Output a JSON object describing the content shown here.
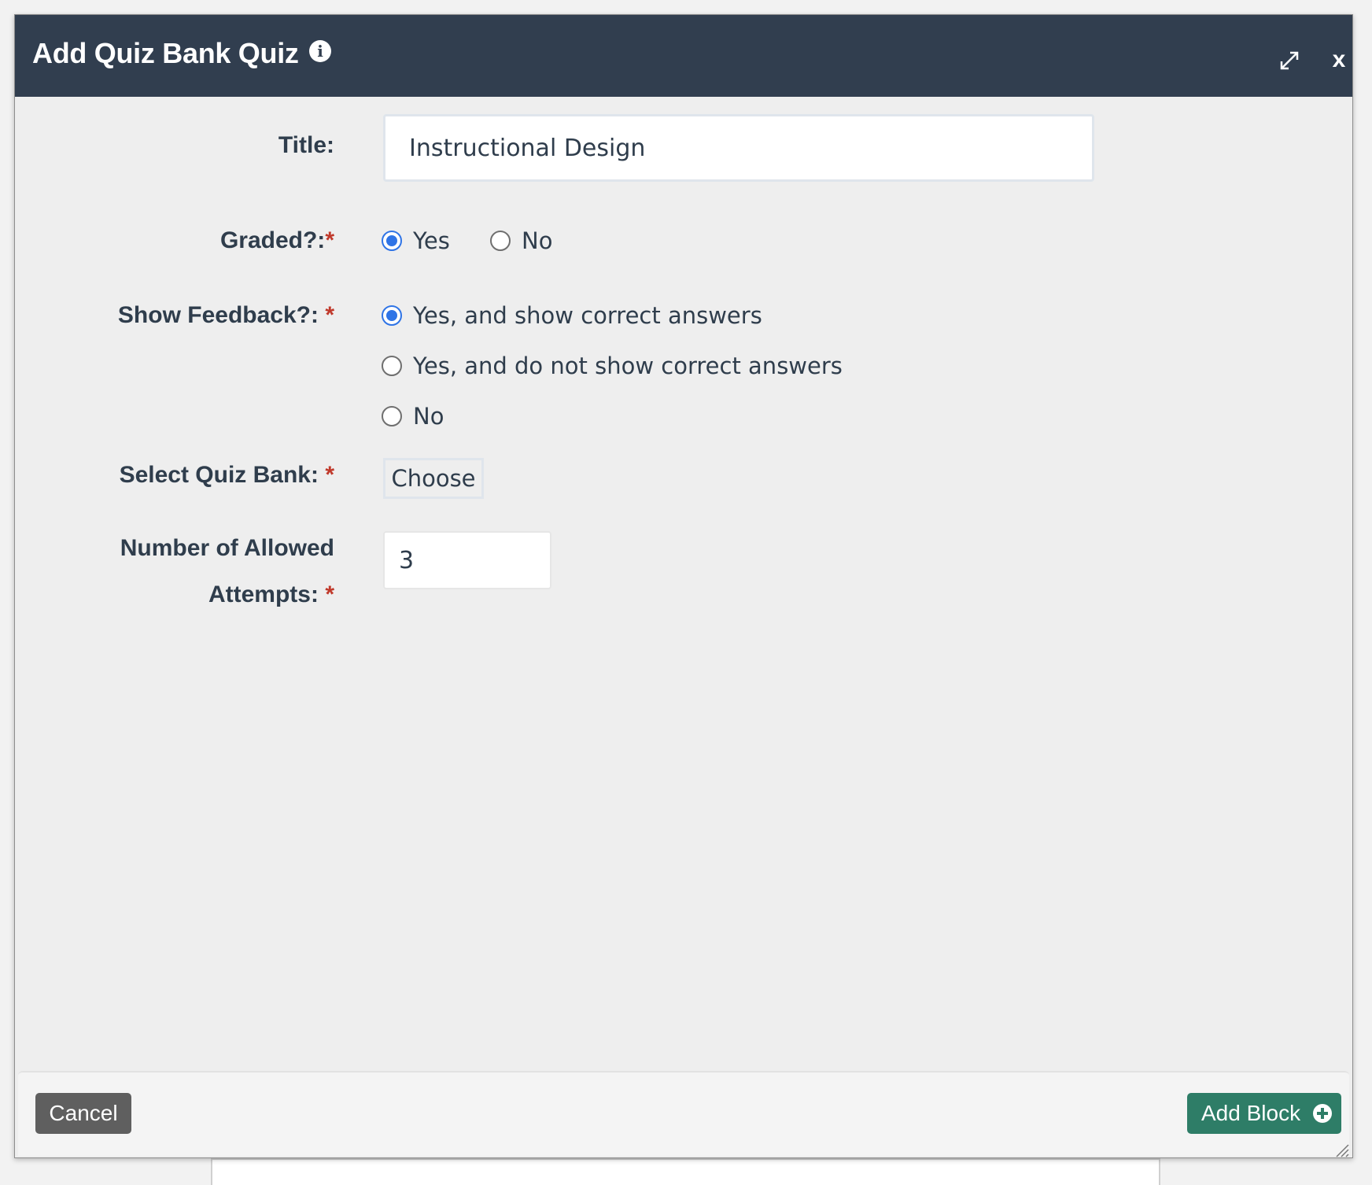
{
  "dialog": {
    "title": "Add Quiz Bank Quiz",
    "info_icon": "i",
    "close_label": "x"
  },
  "form": {
    "title": {
      "label": "Title:",
      "value": "Instructional Design"
    },
    "graded": {
      "label": "Graded?:",
      "required": "*",
      "options": [
        {
          "label": "Yes",
          "checked": true
        },
        {
          "label": "No",
          "checked": false
        }
      ]
    },
    "show_feedback": {
      "label": "Show Feedback?:",
      "required": "*",
      "options": [
        {
          "label": "Yes, and show correct answers",
          "checked": true
        },
        {
          "label": "Yes, and do not show correct answers",
          "checked": false
        },
        {
          "label": "No",
          "checked": false
        }
      ]
    },
    "quiz_bank": {
      "label": "Select Quiz Bank:",
      "required": "*",
      "button_label": "Choose"
    },
    "attempts": {
      "label_line1": "Number of Allowed",
      "label_line2": "Attempts:",
      "required": "*",
      "value": "3"
    }
  },
  "footer": {
    "cancel_label": "Cancel",
    "add_label": "Add Block"
  },
  "colors": {
    "titlebar": "#313e4f",
    "accent_radio": "#2f74e6",
    "required": "#c0392b",
    "add_button": "#2e7d67",
    "cancel_button": "#5f5f5f"
  }
}
